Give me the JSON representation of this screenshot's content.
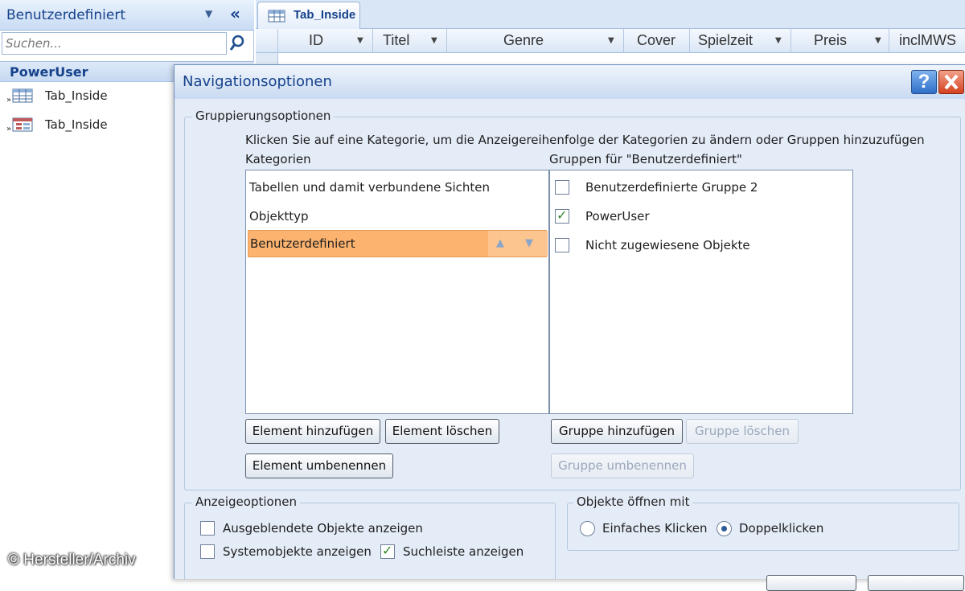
{
  "navpane": {
    "title": "Benutzerdefiniert",
    "search_placeholder": "Suchen...",
    "group_label": "PowerUser",
    "items": [
      {
        "label": "Tab_Inside",
        "icon": "table-icon"
      },
      {
        "label": "Tab_Inside",
        "icon": "form-icon"
      }
    ]
  },
  "table": {
    "tab_label": "Tab_Inside",
    "columns": [
      "ID",
      "Titel",
      "Genre",
      "Cover",
      "Spielzeit",
      "Preis",
      "inclMWS"
    ]
  },
  "dialog": {
    "title": "Navigationsoptionen",
    "help_label": "?",
    "grouping": {
      "legend": "Gruppierungsoptionen",
      "instruction": "Klicken Sie auf eine Kategorie, um die Anzeigereihenfolge der Kategorien zu ändern oder Gruppen hinzuzufügen",
      "categories_label": "Kategorien",
      "groups_label": "Gruppen für \"Benutzerdefiniert\"",
      "categories": [
        "Tabellen und damit verbundene Sichten",
        "Objekttyp",
        "Benutzerdefiniert"
      ],
      "selected_category": "Benutzerdefiniert",
      "groups": [
        {
          "label": "Benutzerdefinierte Gruppe 2",
          "checked": false
        },
        {
          "label": "PowerUser",
          "checked": true
        },
        {
          "label": "Nicht zugewiesene Objekte",
          "checked": false
        }
      ],
      "buttons": {
        "add_element": "Element hinzufügen",
        "delete_element": "Element löschen",
        "rename_element": "Element umbenennen",
        "add_group": "Gruppe hinzufügen",
        "delete_group": "Gruppe löschen",
        "rename_group": "Gruppe umbenennen"
      }
    },
    "display": {
      "legend": "Anzeigeoptionen",
      "show_hidden": "Ausgeblendete Objekte anzeigen",
      "show_hidden_checked": false,
      "show_system": "Systemobjekte anzeigen",
      "show_system_checked": false,
      "show_search": "Suchleiste anzeigen",
      "show_search_checked": true
    },
    "open_with": {
      "legend": "Objekte öffnen mit",
      "single_click": "Einfaches Klicken",
      "double_click": "Doppelklicken",
      "selected": "Doppelklicken"
    }
  },
  "watermark": "© Hersteller/Archiv",
  "colors": {
    "accent": "#15428b",
    "selection": "#fbb36f",
    "dialog_bg": "#e4ecf7"
  }
}
